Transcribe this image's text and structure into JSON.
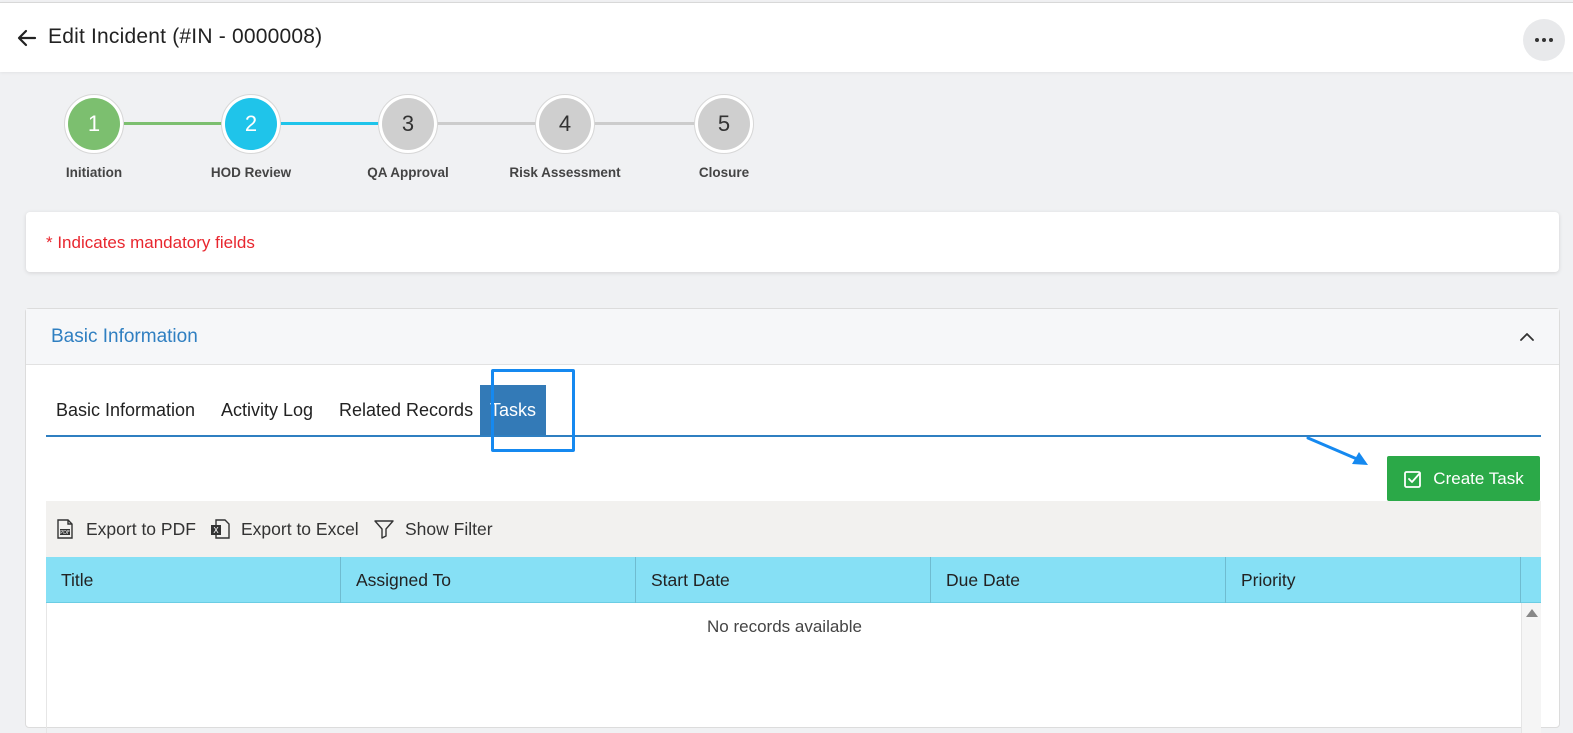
{
  "header": {
    "title": "Edit Incident (#IN - 0000008)"
  },
  "stepper": {
    "steps": [
      {
        "number": "1",
        "label": "Initiation",
        "state": "done"
      },
      {
        "number": "2",
        "label": "HOD Review",
        "state": "active"
      },
      {
        "number": "3",
        "label": "QA Approval",
        "state": "todo"
      },
      {
        "number": "4",
        "label": "Risk Assessment",
        "state": "todo"
      },
      {
        "number": "5",
        "label": "Closure",
        "state": "todo"
      }
    ]
  },
  "notice": {
    "mandatory": "* Indicates mandatory fields"
  },
  "panel": {
    "title": "Basic Information",
    "tabs": [
      {
        "label": "Basic Information"
      },
      {
        "label": "Activity Log"
      },
      {
        "label": "Related Records"
      },
      {
        "label": "Tasks"
      }
    ],
    "active_tab": "Tasks",
    "create_task_label": "Create Task",
    "toolbar": {
      "export_pdf": "Export to PDF",
      "export_excel": "Export to Excel",
      "show_filter": "Show Filter"
    },
    "grid": {
      "columns": [
        "Title",
        "Assigned To",
        "Start Date",
        "Due Date",
        "Priority"
      ],
      "empty_message": "No records available"
    }
  },
  "colors": {
    "accent": "#2f7fc1",
    "done": "#7cbf6f",
    "active": "#1fc4ea",
    "create": "#2ba948",
    "mandatory": "#e8262e",
    "grid_header": "#86e0f5",
    "highlight": "#1589f0"
  }
}
